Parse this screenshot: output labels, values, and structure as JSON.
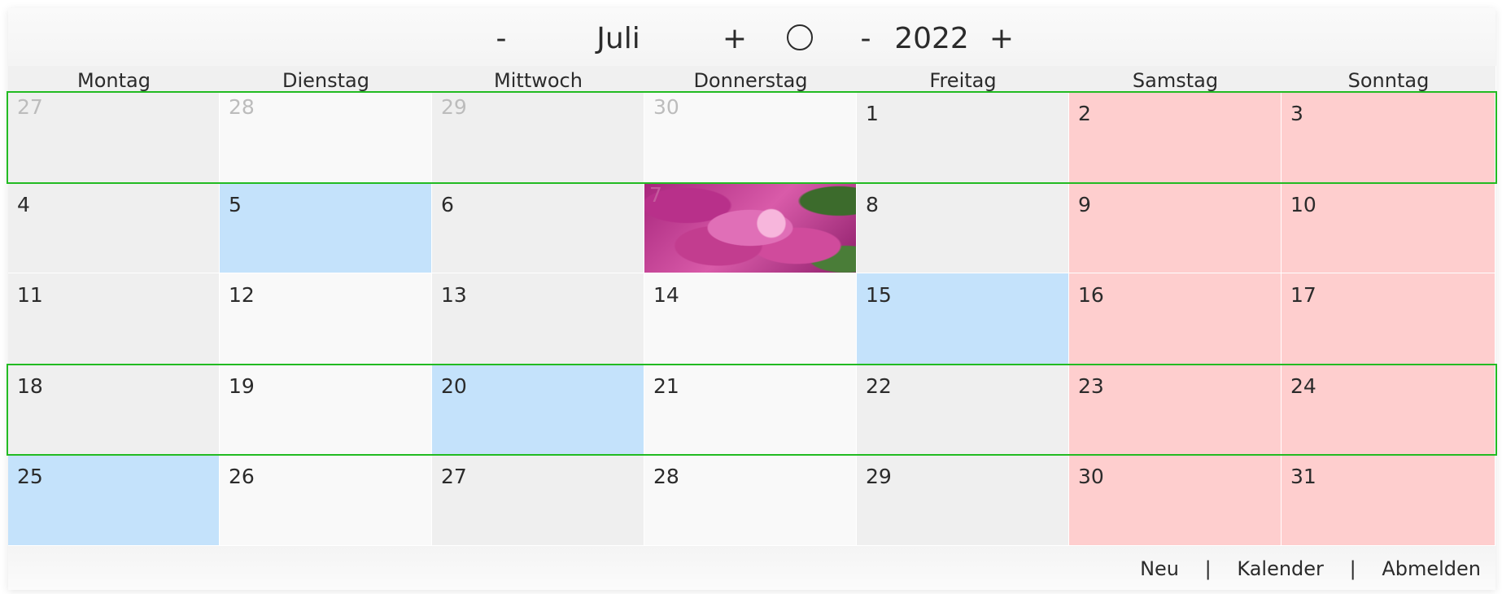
{
  "nav": {
    "month_prev": "-",
    "month": "Juli",
    "month_next": "+",
    "today": "◯",
    "year_prev": "-",
    "year": "2022",
    "year_next": "+"
  },
  "weekdays": [
    "Montag",
    "Dienstag",
    "Mittwoch",
    "Donnerstag",
    "Freitag",
    "Samstag",
    "Sonntag"
  ],
  "weeks": [
    [
      {
        "day": "27",
        "type": "other",
        "shade": "even"
      },
      {
        "day": "28",
        "type": "other",
        "shade": "odd"
      },
      {
        "day": "29",
        "type": "other",
        "shade": "even"
      },
      {
        "day": "30",
        "type": "other",
        "shade": "odd"
      },
      {
        "day": "1",
        "type": "normal",
        "shade": "even"
      },
      {
        "day": "2",
        "type": "weekend"
      },
      {
        "day": "3",
        "type": "weekend"
      }
    ],
    [
      {
        "day": "4",
        "type": "normal",
        "shade": "even"
      },
      {
        "day": "5",
        "type": "event"
      },
      {
        "day": "6",
        "type": "normal",
        "shade": "even"
      },
      {
        "day": "7",
        "type": "image"
      },
      {
        "day": "8",
        "type": "normal",
        "shade": "even"
      },
      {
        "day": "9",
        "type": "weekend"
      },
      {
        "day": "10",
        "type": "weekend"
      }
    ],
    [
      {
        "day": "11",
        "type": "normal",
        "shade": "even"
      },
      {
        "day": "12",
        "type": "normal",
        "shade": "odd"
      },
      {
        "day": "13",
        "type": "normal",
        "shade": "even"
      },
      {
        "day": "14",
        "type": "normal",
        "shade": "odd"
      },
      {
        "day": "15",
        "type": "event"
      },
      {
        "day": "16",
        "type": "weekend"
      },
      {
        "day": "17",
        "type": "weekend"
      }
    ],
    [
      {
        "day": "18",
        "type": "normal",
        "shade": "even"
      },
      {
        "day": "19",
        "type": "normal",
        "shade": "odd"
      },
      {
        "day": "20",
        "type": "event"
      },
      {
        "day": "21",
        "type": "normal",
        "shade": "odd"
      },
      {
        "day": "22",
        "type": "normal",
        "shade": "even"
      },
      {
        "day": "23",
        "type": "weekend"
      },
      {
        "day": "24",
        "type": "weekend"
      }
    ],
    [
      {
        "day": "25",
        "type": "event"
      },
      {
        "day": "26",
        "type": "normal",
        "shade": "odd"
      },
      {
        "day": "27",
        "type": "normal",
        "shade": "even"
      },
      {
        "day": "28",
        "type": "normal",
        "shade": "odd"
      },
      {
        "day": "29",
        "type": "normal",
        "shade": "even"
      },
      {
        "day": "30",
        "type": "weekend"
      },
      {
        "day": "31",
        "type": "weekend"
      }
    ]
  ],
  "highlighted_weeks": [
    0,
    3
  ],
  "footer": {
    "new": "Neu",
    "separator": "|",
    "calendar": "Kalender",
    "logout": "Abmelden"
  },
  "colors": {
    "weekend": "#fecece",
    "event": "#c4e2fb",
    "week_frame": "#22bb22"
  }
}
